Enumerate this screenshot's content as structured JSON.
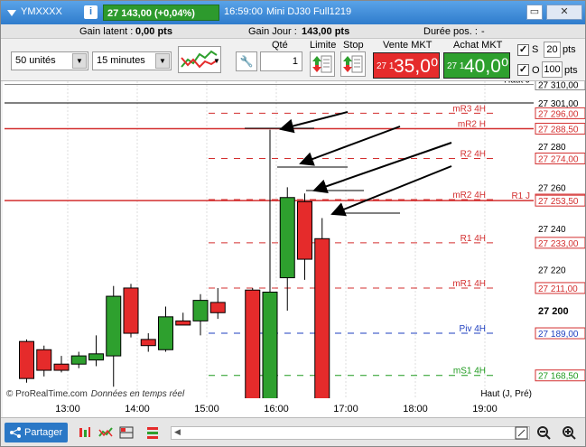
{
  "titlebar": {
    "symbol": "YMXXXX",
    "info_label": "i",
    "price_badge": "27 143,00 (+0,04%)",
    "time": "16:59:00",
    "instrument": "Mini DJ30 Full1219",
    "restore_label": "▭",
    "close_label": "✕"
  },
  "inforow": {
    "latent_label": "Gain latent :",
    "latent_value": "0,00 pts",
    "day_label": "Gain Jour :",
    "day_value": "143,00 pts",
    "duration_label": "Durée pos. :",
    "duration_value": "-"
  },
  "toolbar": {
    "units_value": "50 unités",
    "period_value": "15 minutes",
    "qty_label": "Qté",
    "qty_value": "1",
    "limit_label": "Limite",
    "stop_label": "Stop",
    "sell_label": "Vente MKT",
    "buy_label": "Achat MKT",
    "sell_small": "27 1",
    "sell_big": "35,0⁰",
    "buy_small": "27 1",
    "buy_big": "40,0⁰",
    "s_label": "S",
    "s_value": "20",
    "s_unit": "pts",
    "o_label": "O",
    "o_value": "100",
    "o_unit": "pts",
    "check_mark": "✓"
  },
  "chart_data": {
    "type": "candlestick",
    "x_ticks": [
      "13:00",
      "14:00",
      "15:00",
      "16:00",
      "17:00",
      "18:00",
      "19:00"
    ],
    "y_ticks": [
      "27 220",
      "27 200",
      "27 240",
      "27 260",
      "27 280",
      "27 301,00"
    ],
    "credit_prefix": "© ProRealTime.com",
    "credit_italic": "Données en temps réel",
    "corner_label": "Haut (J, Pré)",
    "levels": [
      {
        "name": "Haut J",
        "value": 27310,
        "price": "27 310,00",
        "color": "#888888",
        "style": "solid",
        "label_color": "#000000"
      },
      {
        "name": "mR3 4H",
        "value": 27296,
        "price": "27 296,00",
        "color": "#d32f2f",
        "style": "dash",
        "label_color": "#d32f2f"
      },
      {
        "name": "mR2 H",
        "value": 27288.5,
        "price": "27 288,50",
        "color": "#d32f2f",
        "style": "solid",
        "label_color": "#d32f2f"
      },
      {
        "name": "R2 4H",
        "value": 27274,
        "price": "27 274,00",
        "color": "#d32f2f",
        "style": "dash",
        "label_color": "#d32f2f"
      },
      {
        "name": "mR2 4H",
        "value": 27254,
        "price": "27 254,00",
        "color": "#d32f2f",
        "style": "dash",
        "label_color": "#d32f2f"
      },
      {
        "name": "R1 J",
        "value": 27253.5,
        "price": "27 253,50",
        "color": "#d32f2f",
        "style": "solid",
        "label_color": "#d32f2f"
      },
      {
        "name": "R1 4H",
        "value": 27233,
        "price": "27 233,00",
        "color": "#d32f2f",
        "style": "dash",
        "label_color": "#d32f2f"
      },
      {
        "name": "mR1 4H",
        "value": 27211,
        "price": "27 211,00",
        "color": "#d32f2f",
        "style": "dash",
        "label_color": "#d32f2f"
      },
      {
        "name": "Piv 4H",
        "value": 27189,
        "price": "27 189,00",
        "color": "#1f3fbf",
        "style": "dash",
        "label_color": "#1f3fbf"
      },
      {
        "name": "mS1 4H",
        "value": 27168.5,
        "price": "27 168,50",
        "color": "#1f9a1f",
        "style": "dash",
        "label_color": "#1f9a1f"
      }
    ],
    "candles": [
      {
        "time": "12:30",
        "open": 27185,
        "high": 27186,
        "low": 27165,
        "close": 27167
      },
      {
        "time": "12:45",
        "open": 27181,
        "high": 27183,
        "low": 27168,
        "close": 27171
      },
      {
        "time": "13:00",
        "open": 27174,
        "high": 27178,
        "low": 27170,
        "close": 27171
      },
      {
        "time": "13:15",
        "open": 27174,
        "high": 27180,
        "low": 27172,
        "close": 27178
      },
      {
        "time": "13:30",
        "open": 27176,
        "high": 27188,
        "low": 27173,
        "close": 27179
      },
      {
        "time": "13:45",
        "open": 27178,
        "high": 27212,
        "low": 27163,
        "close": 27207
      },
      {
        "time": "14:00",
        "open": 27211,
        "high": 27213,
        "low": 27187,
        "close": 27189
      },
      {
        "time": "14:15",
        "open": 27186,
        "high": 27189,
        "low": 27180,
        "close": 27183
      },
      {
        "time": "14:30",
        "open": 27181,
        "high": 27202,
        "low": 27180,
        "close": 27197
      },
      {
        "time": "14:45",
        "open": 27195,
        "high": 27199,
        "low": 27193,
        "close": 27193
      },
      {
        "time": "15:00",
        "open": 27195,
        "high": 27208,
        "low": 27188,
        "close": 27205
      },
      {
        "time": "15:15",
        "open": 27204,
        "high": 27211,
        "low": 27196,
        "close": 27199
      },
      {
        "time": "15:45",
        "open": 27210,
        "high": 27211,
        "low": 27150,
        "close": 27150
      },
      {
        "time": "16:00",
        "open": 27150,
        "high": 27288,
        "low": 27150,
        "close": 27209
      },
      {
        "time": "16:15",
        "open": 27216,
        "high": 27260,
        "low": 27200,
        "close": 27255
      },
      {
        "time": "16:30",
        "open": 27253,
        "high": 27257,
        "low": 27215,
        "close": 27225
      },
      {
        "time": "16:45",
        "open": 27235,
        "high": 27245,
        "low": 27150,
        "close": 27150
      }
    ]
  },
  "bottombar": {
    "share_label": "Partager"
  },
  "colors": {
    "up": "#2ea02e",
    "down": "#e52b2b",
    "price_box_border": "#d32f2f",
    "title_blue": "#2f7ccc"
  }
}
